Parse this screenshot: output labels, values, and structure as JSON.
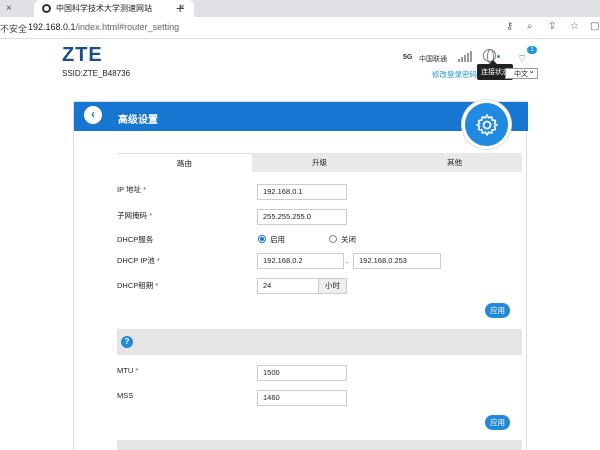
{
  "browser": {
    "tab_title": "中国科学技术大学测速网站",
    "tab_close_left": "×",
    "tab_close": "×",
    "new_tab": "+",
    "security_label": "不安全",
    "url_host": "192.168.0.1",
    "url_path": "/index.html#router_setting",
    "icons": [
      "key-icon",
      "zoom-icon",
      "share-icon",
      "star-icon",
      "profile-icon"
    ]
  },
  "header": {
    "logo": "ZTE",
    "ssid": "SSID:ZTE_B48736",
    "network_type": "5G",
    "carrier": "中国联通",
    "wifi_badge_count": "1",
    "tooltip": "连接状态",
    "change_password": "修改登录密码",
    "language": "中文"
  },
  "panel": {
    "title": "高级设置",
    "tabs": [
      "路由",
      "升级",
      "其他"
    ],
    "active_tab": "路由"
  },
  "router_form": {
    "ip_label": "IP 地址",
    "ip_value": "192.168.0.1",
    "subnet_label": "子网掩码",
    "subnet_value": "255.255.255.0",
    "dhcp_label": "DHCP服务",
    "dhcp_on": "启用",
    "dhcp_off": "关闭",
    "pool_label": "DHCP IP池",
    "pool_start": "192.168.0.2",
    "pool_end": "192.168.0.253",
    "lease_label": "DHCP租期",
    "lease_value": "24",
    "lease_unit": "小时",
    "required_mark": "*",
    "apply": "应用"
  },
  "mtu_form": {
    "help_glyph": "?",
    "mtu_label": "MTU",
    "mtu_value": "1500",
    "mss_label": "MSS",
    "mss_value": "1460",
    "apply": "应用"
  },
  "colors": {
    "accent": "#1776cf",
    "brand": "#1b4d91"
  }
}
